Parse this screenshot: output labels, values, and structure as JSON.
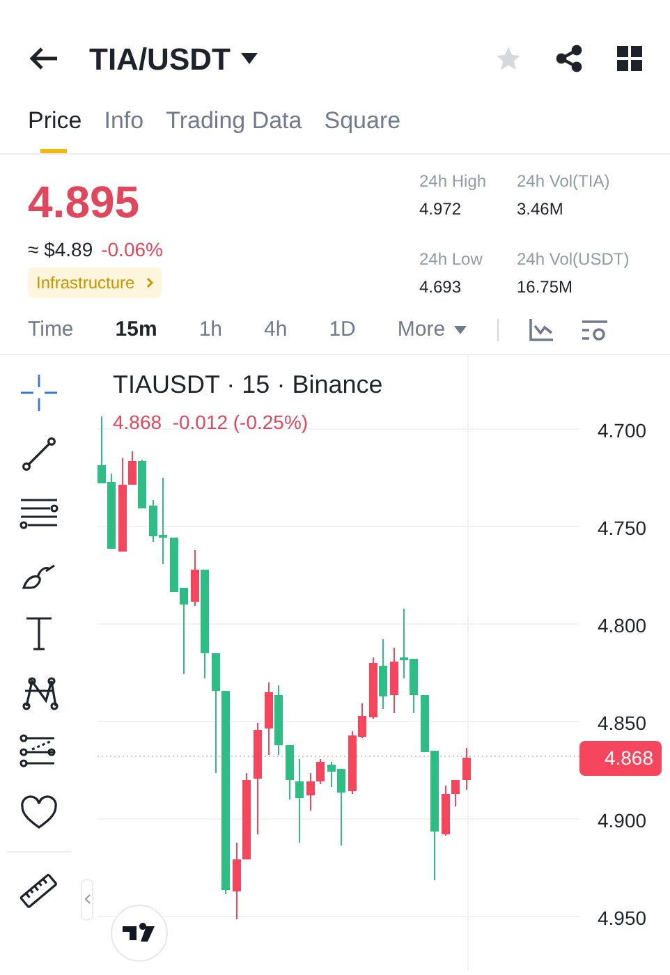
{
  "header": {
    "title": "TIA/USDT",
    "favorite": false
  },
  "tabs": [
    {
      "label": "Price",
      "selected": true
    },
    {
      "label": "Info",
      "selected": false
    },
    {
      "label": "Trading Data",
      "selected": false
    },
    {
      "label": "Square",
      "selected": false
    }
  ],
  "price": {
    "last": "4.895",
    "approx": "≈ $4.89",
    "change": "-0.06%",
    "sector": "Infrastructure"
  },
  "stats": [
    {
      "label": "24h High",
      "value": "4.972"
    },
    {
      "label": "24h Vol(TIA)",
      "value": "3.46M"
    },
    {
      "label": "24h Low",
      "value": "4.693"
    },
    {
      "label": "24h Vol(USDT)",
      "value": "16.75M"
    }
  ],
  "intervals": [
    {
      "label": "Time",
      "selected": false
    },
    {
      "label": "15m",
      "selected": true
    },
    {
      "label": "1h",
      "selected": false
    },
    {
      "label": "4h",
      "selected": false
    },
    {
      "label": "1D",
      "selected": false
    }
  ],
  "more": "More",
  "chart": {
    "symbol_line": "TIAUSDT · 15 · Binance",
    "ohlc_line": "4.868  -0.012 (-0.25%)",
    "price_axis": [
      "4.700",
      "4.750",
      "4.800",
      "4.850",
      "4.900",
      "4.950"
    ],
    "last_price_tag": "4.868"
  }
}
